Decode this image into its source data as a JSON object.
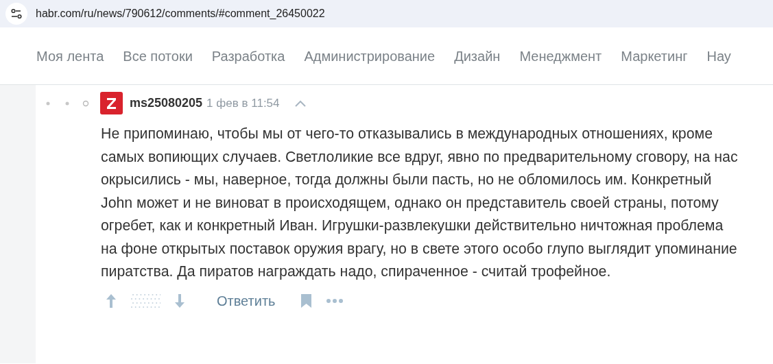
{
  "address_bar": {
    "url": "habr.com/ru/news/790612/comments/#comment_26450022"
  },
  "nav": {
    "items": [
      {
        "label": "Моя лента",
        "selected": false
      },
      {
        "label": "Все потоки",
        "selected": false
      },
      {
        "label": "Разработка",
        "selected": false
      },
      {
        "label": "Администрирование",
        "selected": false
      },
      {
        "label": "Дизайн",
        "selected": false
      },
      {
        "label": "Менеджмент",
        "selected": false
      },
      {
        "label": "Маркетинг",
        "selected": false
      },
      {
        "label": "Нау",
        "selected": false
      }
    ]
  },
  "comment": {
    "author": "ms25080205",
    "time": "1 фев в 11:54",
    "text": "Не припоминаю, чтобы мы от чего-то отказывались в международных отношениях, кроме самых вопиющих случаев. Светлоликие все вдруг, явно по предварительному сговору, на нас окрысились - мы, наверное, тогда должны были пасть, но не обломилось им. Конкретный John может и не виноват в происходящем, однако он представитель своей страны, потому огребет, как и конкретный Иван. Игрушки-развлекушки действительно ничтожная проблема на фоне открытых поставок оружия врагу, но в свете этого особо глупо выглядит упоминание пиратства. Да пиратов награждать надо, спираченное - считай трофейное.",
    "reply": "Ответить",
    "bookmarked": false
  }
}
